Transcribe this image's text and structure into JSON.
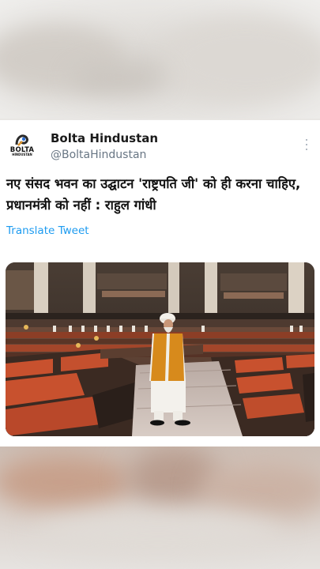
{
  "tweet": {
    "author_name": "Bolta Hindustan",
    "author_handle": "@BoltaHindustan",
    "avatar_logo_top": "BOLTA",
    "avatar_logo_bottom": "HINDUSTAN",
    "text": "नए संसद भवन का उद्घाटन 'राष्ट्रपति जी' को ही करना चाहिए, प्रधानमंत्री को नहीं : राहुल गांधी",
    "translate_label": "Translate Tweet",
    "more_icon": "more-vertical-icon"
  },
  "colors": {
    "link": "#1d9bf0",
    "handle": "#687684",
    "seat": "#c8512e",
    "jacket": "#d78a1c"
  }
}
